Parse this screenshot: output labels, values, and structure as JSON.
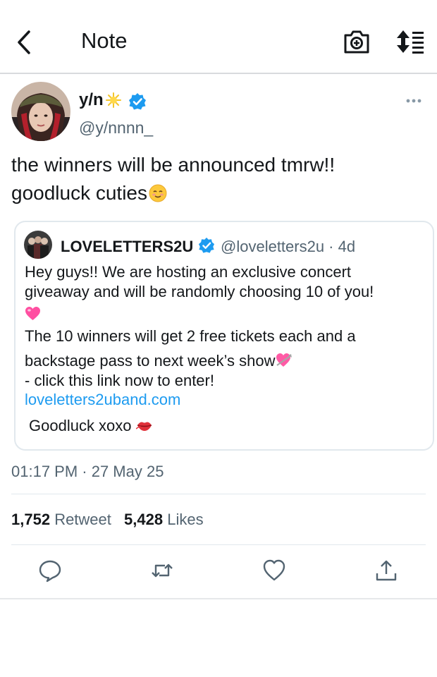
{
  "header": {
    "title": "Note",
    "back_icon": "chevron-left-icon",
    "camera_icon": "camera-plus-icon",
    "sort_icon": "sort-list-icon"
  },
  "tweet": {
    "author_name": "y/n",
    "author_handle": "@y/nnnn_",
    "text_line1": "the winners will be announced tmrw!!",
    "text_line2": "goodluck cuties",
    "timestamp": "01:17 PM · 27 May 25",
    "retweet_count": "1,752",
    "retweet_label": "Retweet",
    "likes_count": "5,428",
    "likes_label": "Likes"
  },
  "quote": {
    "name": "LOVELETTERS2U",
    "meta": "@loveletters2u · 4d",
    "line1": "Hey guys!! We are hosting an exclusive concert",
    "line2": "giveaway and will be randomly choosing 10 of you!",
    "line3": "The 10 winners will get 2 free tickets each and a",
    "line4": "backstage pass to next week’s show",
    "line5": "- click this link now to enter!",
    "link": "loveletters2uband.com",
    "signoff": "Goodluck xoxo"
  },
  "colors": {
    "accent": "#1d9bf0",
    "verified": "#1d9bf0",
    "text": "#14171a",
    "secondary": "#536471",
    "border": "#e1e8ed"
  }
}
